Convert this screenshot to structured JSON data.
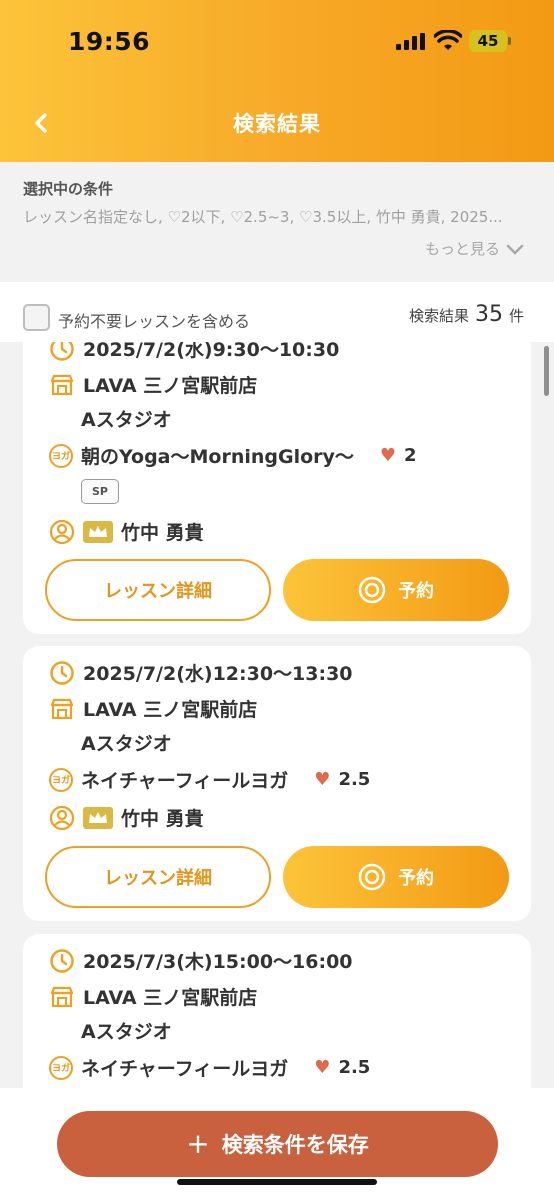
{
  "status_bar": {
    "time": "19:56",
    "battery": "45"
  },
  "header": {
    "title": "検索結果"
  },
  "conditions": {
    "label": "選択中の条件",
    "text": "レッスン名指定なし, ♡2以下, ♡2.5~3, ♡3.5以上, 竹中 勇貴, 2025...",
    "more_label": "もっと見る"
  },
  "filter": {
    "checkbox_label": "予約不要レッスンを含める",
    "result_prefix": "検索結果",
    "result_count": "35",
    "result_suffix": "件"
  },
  "colors": {
    "accent": "#f39a14",
    "accent_light": "#fcc43a",
    "save_button": "#c9613e",
    "heart": "#e06a4e",
    "crown": "#d9b942"
  },
  "lessons": [
    {
      "datetime": "2025/7/2(水)9:30〜10:30",
      "studio": "LAVA 三ノ宮駅前店",
      "room": "Aスタジオ",
      "yoga_icon": "ヨガ",
      "program": "朝のYoga〜MorningGlory〜",
      "rating": "2",
      "badge": "SP",
      "instructor": "竹中 勇貴",
      "detail_label": "レッスン詳細",
      "reserve_label": "予約"
    },
    {
      "datetime": "2025/7/2(水)12:30〜13:30",
      "studio": "LAVA 三ノ宮駅前店",
      "room": "Aスタジオ",
      "yoga_icon": "ヨガ",
      "program": "ネイチャーフィールヨガ",
      "rating": "2.5",
      "instructor": "竹中 勇貴",
      "detail_label": "レッスン詳細",
      "reserve_label": "予約"
    },
    {
      "datetime": "2025/7/3(木)15:00〜16:00",
      "studio": "LAVA 三ノ宮駅前店",
      "room": "Aスタジオ",
      "yoga_icon": "ヨガ",
      "program": "ネイチャーフィールヨガ",
      "rating": "2.5"
    }
  ],
  "bottom": {
    "save_label": "検索条件を保存",
    "save_icon": "plus-icon"
  }
}
